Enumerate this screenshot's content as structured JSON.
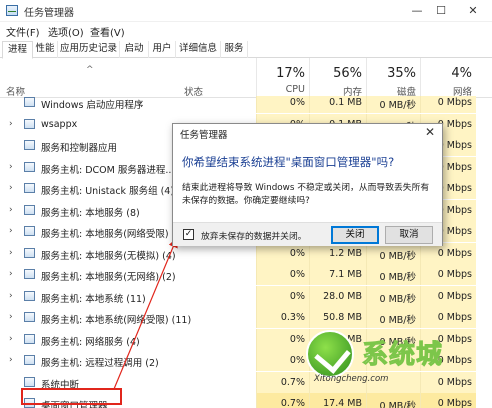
{
  "window": {
    "title": "任务管理器",
    "minimize": "—",
    "maximize": "☐",
    "close": "✕"
  },
  "menu": [
    "文件(F)",
    "选项(O)",
    "查看(V)"
  ],
  "tabs": [
    "进程",
    "性能",
    "应用历史记录",
    "启动",
    "用户",
    "详细信息",
    "服务"
  ],
  "active_tab": "进程",
  "columns": {
    "name": "名称",
    "status": "状态",
    "cpu": {
      "pct": "17%",
      "label": "CPU"
    },
    "memory": {
      "pct": "56%",
      "label": "内存"
    },
    "disk": {
      "pct": "35%",
      "label": "磁盘"
    },
    "network": {
      "pct": "4%",
      "label": "网络"
    }
  },
  "processes": [
    {
      "name": "Windows 启动应用程序",
      "expand": "",
      "cpu": "0%",
      "mem": "0.1 MB",
      "disk": "0 MB/秒",
      "net": "0 Mbps"
    },
    {
      "name": "wsappx",
      "expand": "›",
      "cpu": "0%",
      "mem": "0.1 MB",
      "disk": "0 MB/秒",
      "net": "0 Mbps"
    },
    {
      "name": "服务和控制器应用",
      "expand": "",
      "cpu": "0%",
      "mem": "",
      "disk": "",
      "net": "0 Mbps"
    },
    {
      "name": "服务主机: DCOM 服务器进程...",
      "expand": "›",
      "cpu": "",
      "mem": "",
      "disk": "",
      "net": "0 Mbps"
    },
    {
      "name": "服务主机: Unistack 服务组 (4)",
      "expand": "›",
      "cpu": "",
      "mem": "",
      "disk": "",
      "net": "0 Mbps"
    },
    {
      "name": "服务主机: 本地服务 (8)",
      "expand": "›",
      "cpu": "",
      "mem": "",
      "disk": "",
      "net": "0 Mbps"
    },
    {
      "name": "服务主机: 本地服务(网络受限) (6)",
      "expand": "›",
      "cpu": "",
      "mem": "",
      "disk": "",
      "net": "0 Mbps"
    },
    {
      "name": "服务主机: 本地服务(无模拟) (4)",
      "expand": "›",
      "cpu": "0%",
      "mem": "1.2 MB",
      "disk": "0 MB/秒",
      "net": "0 Mbps"
    },
    {
      "name": "服务主机: 本地服务(无网络) (2)",
      "expand": "›",
      "cpu": "0%",
      "mem": "7.1 MB",
      "disk": "0 MB/秒",
      "net": "0 Mbps"
    },
    {
      "name": "服务主机: 本地系统 (11)",
      "expand": "›",
      "cpu": "0%",
      "mem": "28.0 MB",
      "disk": "0 MB/秒",
      "net": "0 Mbps"
    },
    {
      "name": "服务主机: 本地系统(网络受限) (11)",
      "expand": "›",
      "cpu": "0.3%",
      "mem": "50.8 MB",
      "disk": "0 MB/秒",
      "net": "0 Mbps"
    },
    {
      "name": "服务主机: 网络服务 (4)",
      "expand": "›",
      "cpu": "0%",
      "mem": "10.9 MB",
      "disk": "0 MB/秒",
      "net": "0 Mbps"
    },
    {
      "name": "服务主机: 远程过程调用 (2)",
      "expand": "›",
      "cpu": "0%",
      "mem": "",
      "disk": "",
      "net": "0 Mbps"
    },
    {
      "name": "系统中断",
      "expand": "",
      "cpu": "0.7%",
      "mem": "",
      "disk": "",
      "net": "0 Mbps"
    },
    {
      "name": "桌面窗口管理器",
      "expand": "",
      "cpu": "0.7%",
      "mem": "17.4 MB",
      "disk": "0 MB/秒",
      "net": "0 Mbps"
    }
  ],
  "dialog": {
    "title": "任务管理器",
    "close": "✕",
    "heading": "你希望结束系统进程\"桌面窗口管理器\"吗?",
    "body": "结束此进程将导致 Windows 不稳定或关闭，从而导致丢失所有未保存的数据。你确定要继续吗?",
    "checkbox_mark": "✓",
    "checkbox_label": "放弃未保存的数据并关闭。",
    "checkbox_checked": true,
    "primary_button": "关闭",
    "secondary_button": "取消"
  },
  "watermark": {
    "text": "系统城",
    "url": "Xitongcheng.com"
  }
}
